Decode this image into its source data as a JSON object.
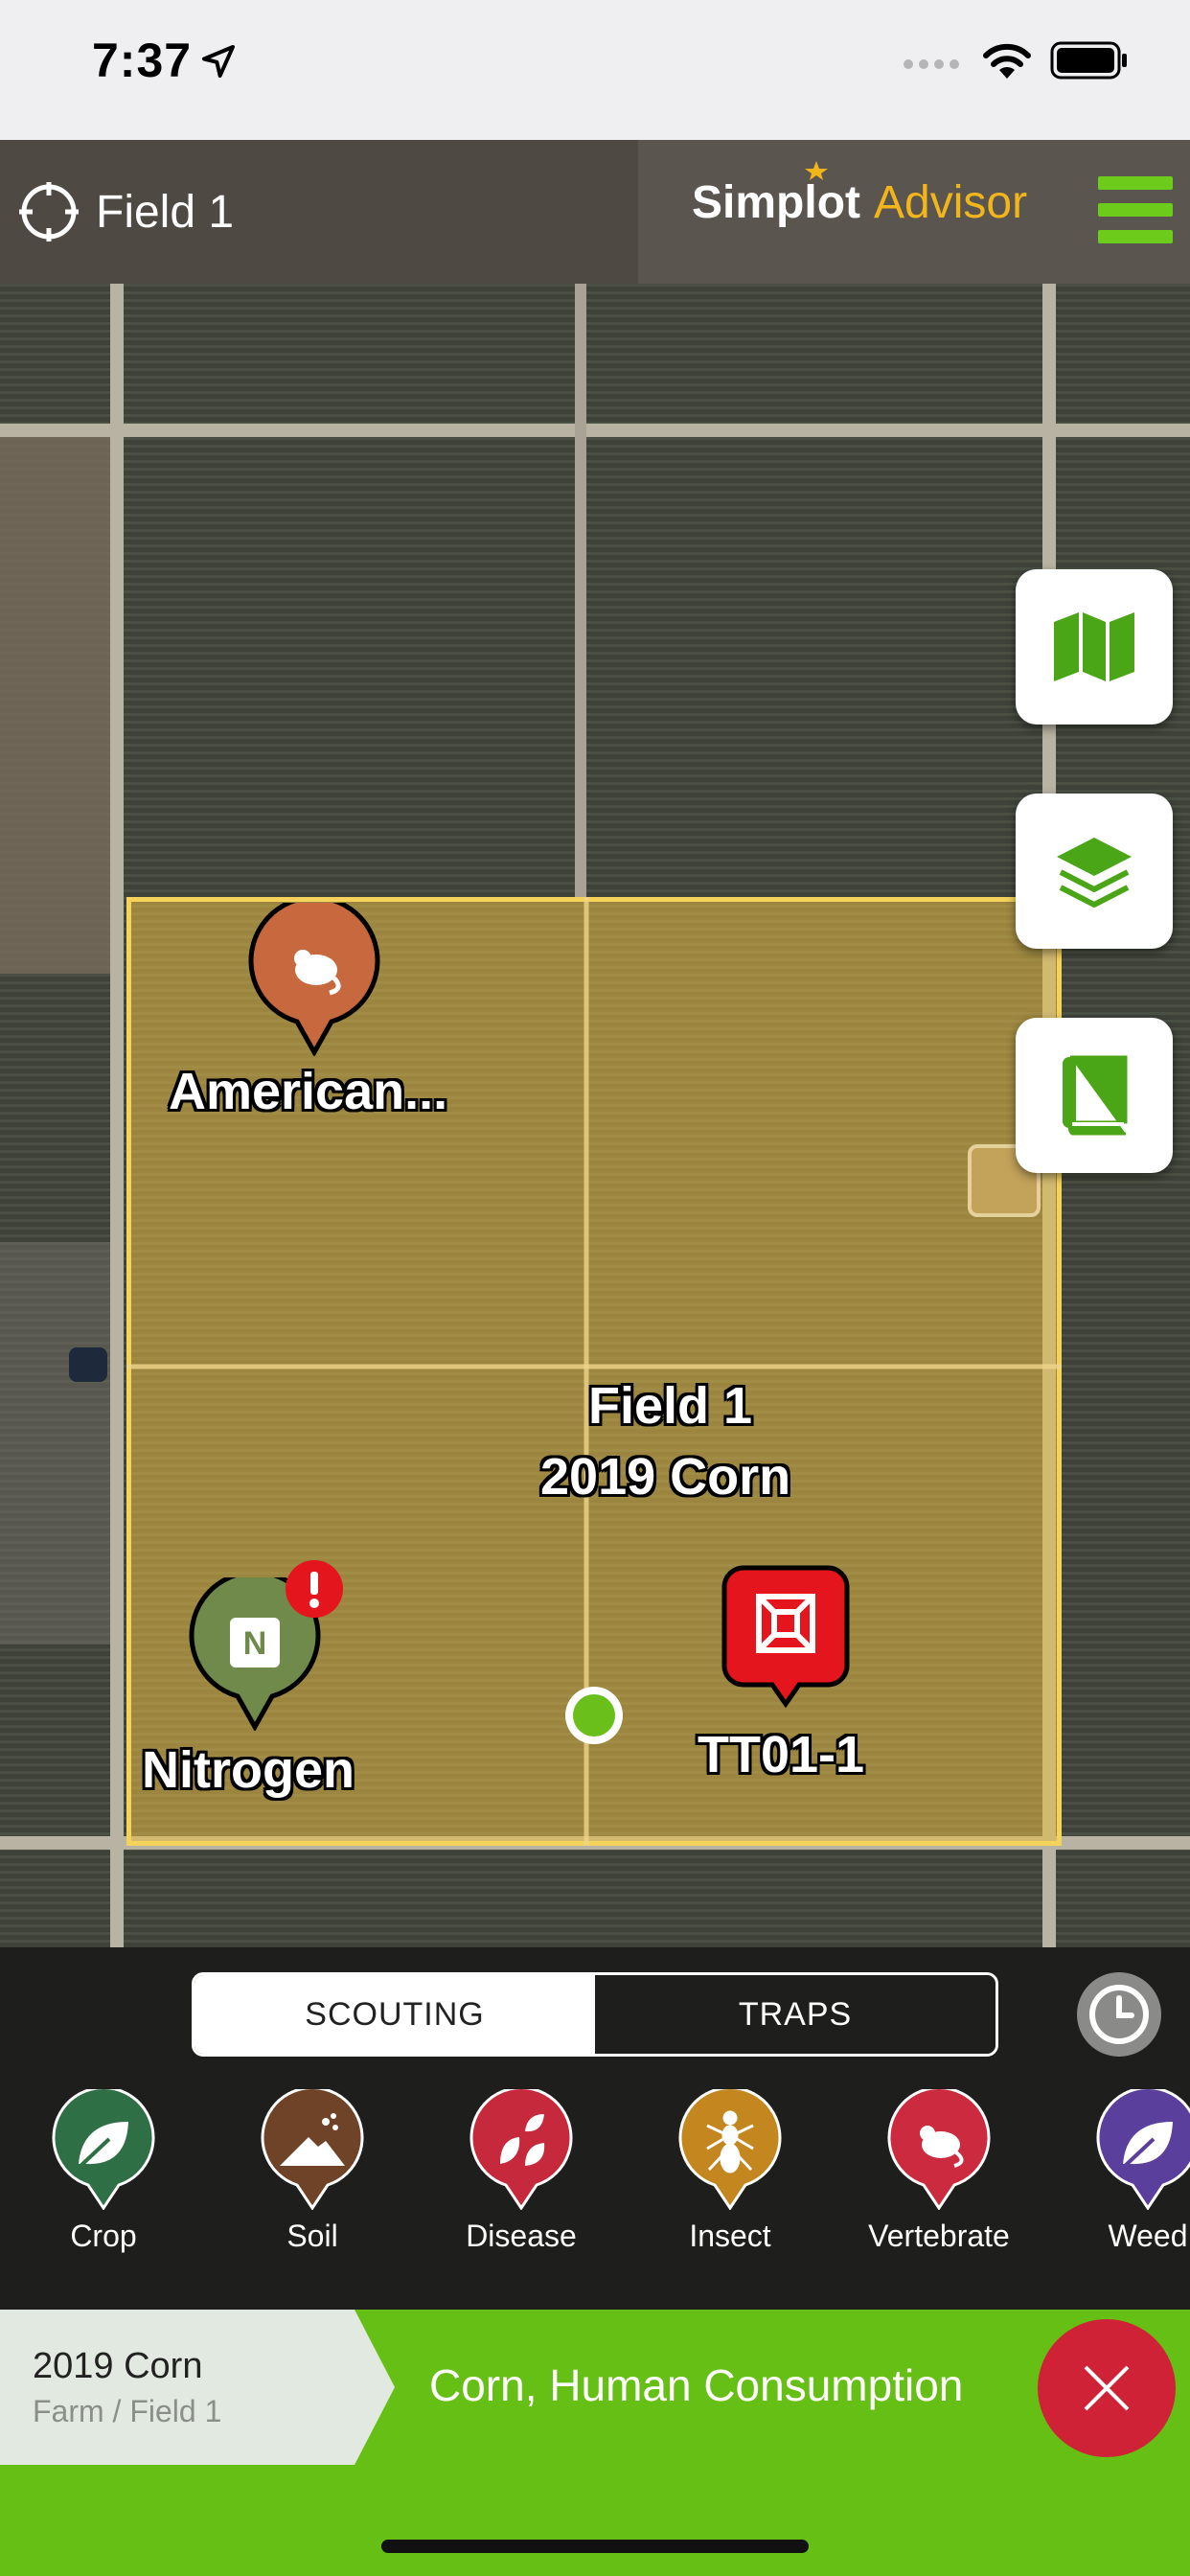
{
  "status_bar": {
    "time": "7:37"
  },
  "header": {
    "field_title": "Field 1",
    "brand_primary": "Simplot",
    "brand_secondary": "Advisor"
  },
  "map": {
    "markers": [
      {
        "label": "American...",
        "icon": "rodent-icon",
        "color": "#c8683f"
      },
      {
        "label": "Field 1",
        "sublabel": "2019 Corn",
        "icon": "location-dot-icon",
        "color": "#6bbf1b"
      },
      {
        "label": "Nitrogen",
        "icon": "nitrogen-icon",
        "color": "#6f8a4a",
        "alert": "!"
      },
      {
        "label": "TT01-1",
        "icon": "trap-icon",
        "color": "#e4151c"
      }
    ],
    "buttons": [
      {
        "name": "map-view",
        "icon": "folded-map-icon"
      },
      {
        "name": "layers",
        "icon": "layers-icon"
      },
      {
        "name": "guide",
        "icon": "book-icon"
      }
    ]
  },
  "tabs": {
    "scouting": "SCOUTING",
    "traps": "TRAPS",
    "active": "SCOUTING"
  },
  "categories": [
    {
      "label": "Crop",
      "icon": "leaf-icon",
      "color": "#2f6f45"
    },
    {
      "label": "Soil",
      "icon": "soil-icon",
      "color": "#6f4327"
    },
    {
      "label": "Disease",
      "icon": "disease-icon",
      "color": "#c6283c"
    },
    {
      "label": "Insect",
      "icon": "insect-icon",
      "color": "#c4861f"
    },
    {
      "label": "Vertebrate",
      "icon": "rodent-icon",
      "color": "#cc2a3e"
    },
    {
      "label": "Weed",
      "icon": "leaf-icon",
      "color": "#5a3f9c"
    }
  ],
  "footer": {
    "crop_name": "2019 Corn",
    "crop_path": "Farm / Field 1",
    "crop_description": "Corn, Human Consumption"
  },
  "colors": {
    "brand_green": "#66bf14",
    "brand_orange": "#f2b61b",
    "close_red": "#cf2237"
  }
}
